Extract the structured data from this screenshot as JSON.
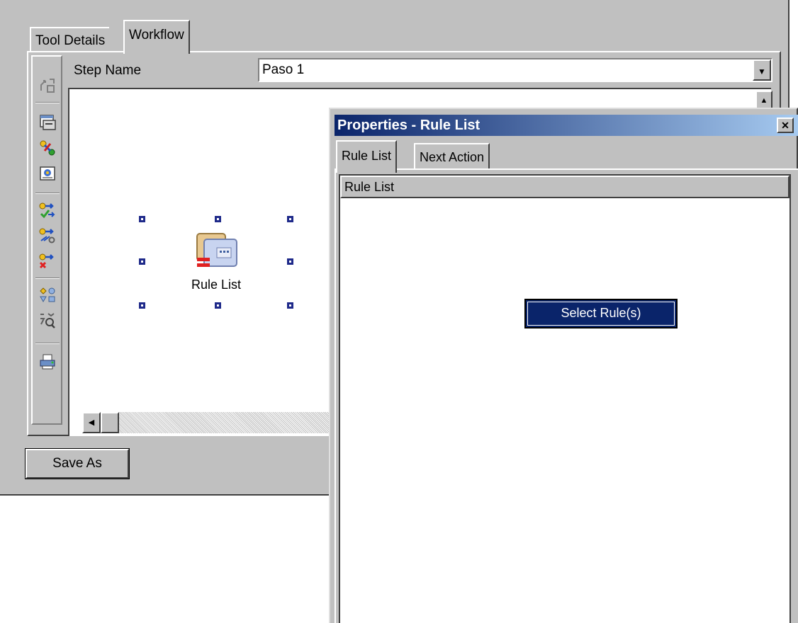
{
  "main": {
    "tabs": [
      {
        "label": "Tool Details",
        "active": false
      },
      {
        "label": "Workflow",
        "active": true
      }
    ],
    "step_name_label": "Step Name",
    "step_name_value": "Paso 1",
    "save_as_label": "Save As"
  },
  "toolbar": {
    "icons": [
      "workflow-icon",
      "window-icon",
      "connect-icon",
      "properties-icon",
      "check-route-icon",
      "settings-route-icon",
      "delete-route-icon",
      "shapes-icon",
      "zoom-icon",
      "print-icon"
    ]
  },
  "canvas": {
    "node_label": "Rule List",
    "node_icon": "rule-list-icon"
  },
  "properties": {
    "title": "Properties - Rule List",
    "tabs": [
      {
        "label": "Rule List",
        "active": true
      },
      {
        "label": "Next Action",
        "active": false
      }
    ],
    "list_header": "Rule List",
    "select_button_label": "Select Rule(s)"
  },
  "colors": {
    "window_bg": "#c0c0c0",
    "titlebar_start": "#0a246a",
    "titlebar_end": "#a6caf0",
    "handle": "#1f2a8a"
  }
}
